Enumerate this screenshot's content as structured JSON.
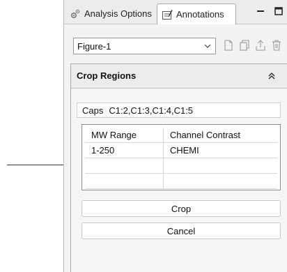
{
  "tabs": [
    {
      "label": "Analysis Options",
      "icon": "gears-icon"
    },
    {
      "label": "Annotations",
      "icon": "annotations-icon"
    }
  ],
  "window_controls": [
    "minimize-icon",
    "maximize-icon"
  ],
  "figure_select": {
    "value": "Figure-1"
  },
  "toolbar_icons": [
    "new-document-icon",
    "copy-icon",
    "export-icon",
    "delete-icon"
  ],
  "crop_regions": {
    "title": "Crop Regions",
    "caps_label": "Caps",
    "caps_value": "C1:2,C1:3,C1:4,C1:5",
    "table": {
      "headers": [
        "MW Range",
        "Channel Contrast"
      ],
      "rows": [
        [
          "1-250",
          "CHEMI"
        ],
        [
          "",
          ""
        ],
        [
          "",
          ""
        ]
      ]
    },
    "crop_button": "Crop",
    "cancel_button": "Cancel"
  },
  "colors": {
    "panel_bg": "#f3f3f3",
    "border": "#a9a9a9",
    "arrow": "#333333"
  }
}
